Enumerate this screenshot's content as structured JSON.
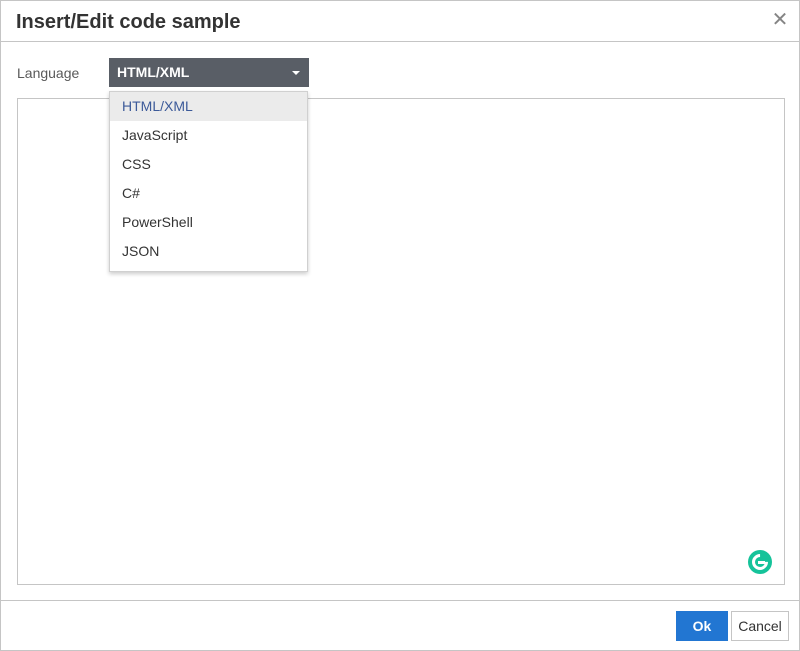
{
  "dialog": {
    "title": "Insert/Edit code sample",
    "close_icon": "close-icon",
    "close_glyph": "✕"
  },
  "language": {
    "label": "Language",
    "selected": "HTML/XML",
    "options": [
      "HTML/XML",
      "JavaScript",
      "CSS",
      "C#",
      "PowerShell",
      "JSON"
    ]
  },
  "code": {
    "value": ""
  },
  "footer": {
    "ok_label": "Ok",
    "cancel_label": "Cancel"
  },
  "colors": {
    "select_bg": "#595e66",
    "primary": "#2276d2",
    "grammarly": "#15c39a",
    "selected_option_text": "#3c5a99"
  }
}
